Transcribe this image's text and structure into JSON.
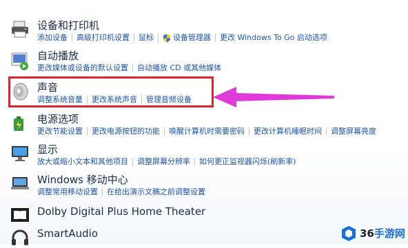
{
  "sections": {
    "devices": {
      "title": "设备和打印机",
      "links": [
        "添加设备",
        "高级打印机设置",
        "鼠标",
        "设备管理器",
        "更改 Windows To Go 启动选项"
      ]
    },
    "autoplay": {
      "title": "自动播放",
      "links": [
        "更改媒体或设备的默认设置",
        "自动播放 CD 或其他媒体"
      ]
    },
    "sound": {
      "title": "声音",
      "links": [
        "调整系统音量",
        "更改系统声音",
        "管理音频设备"
      ]
    },
    "power": {
      "title": "电源选项",
      "links": [
        "更改节能设置",
        "更改电源按钮的功能",
        "唤醒计算机时需要密码",
        "更改计算机睡眠时间",
        "调整屏幕亮度"
      ]
    },
    "display": {
      "title": "显示",
      "links": [
        "放大或缩小文本和其他项目",
        "调整屏幕分辨率",
        "如何更正监视器闪烁(刷新率)"
      ]
    },
    "mobility": {
      "title": "Windows 移动中心",
      "links": [
        "调整常用移动设置",
        "在给出演示文稿之前调整设置"
      ]
    },
    "dolby": {
      "title": "Dolby Digital Plus Home Theater"
    },
    "smartaudio": {
      "title": "SmartAudio"
    }
  },
  "watermark": {
    "number": "36",
    "suffix": "手游网"
  },
  "colors": {
    "link": "#1c55a8",
    "highlight": "#e0222b",
    "arrow": "#e03ad8"
  }
}
